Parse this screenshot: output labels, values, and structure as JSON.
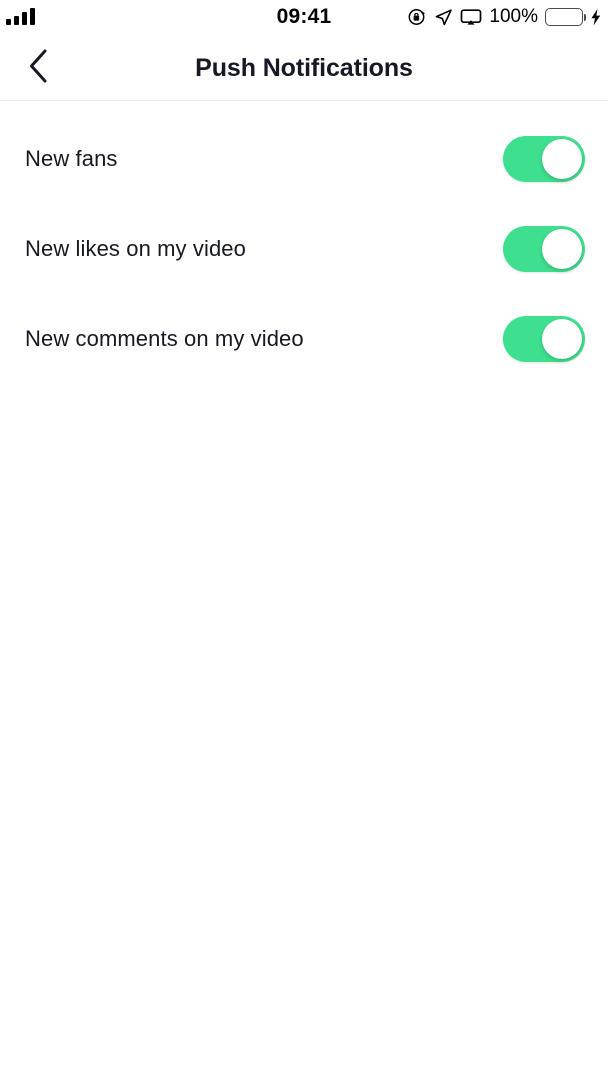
{
  "status_bar": {
    "signal_bars": 4,
    "time": "09:41",
    "battery_percent": "100%",
    "battery_color": "#5ee05e",
    "icons": [
      "signal-bars-icon",
      "rotation-lock-icon",
      "location-arrow-icon",
      "airplay-icon",
      "battery-icon",
      "charging-bolt-icon"
    ]
  },
  "header": {
    "back_label": "chevron-left-icon",
    "title": "Push Notifications"
  },
  "settings": {
    "accent_color": "#3ee08f",
    "rows": [
      {
        "label": "New fans",
        "state": "on"
      },
      {
        "label": "New likes on my video",
        "state": "on"
      },
      {
        "label": "New comments on my video",
        "state": "on"
      }
    ]
  }
}
